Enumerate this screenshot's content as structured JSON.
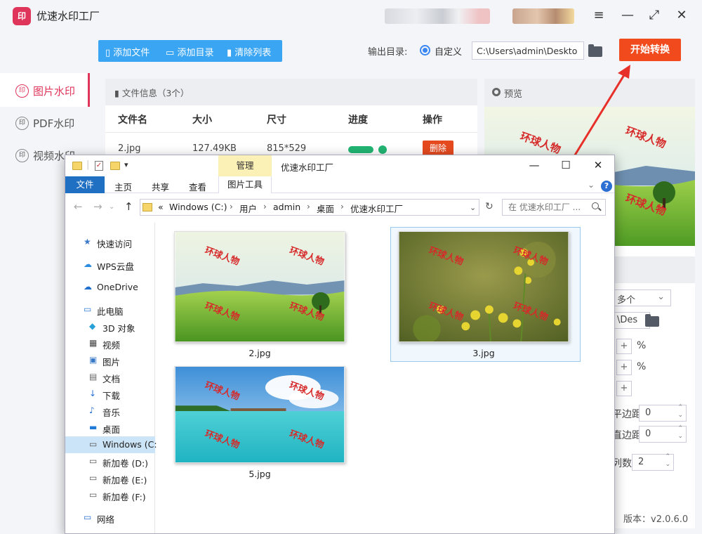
{
  "app": {
    "title": "优速水印工厂",
    "logo_text": "印",
    "window_controls": [
      "menu-icon",
      "minimize-icon",
      "maximize-icon",
      "close-icon"
    ]
  },
  "toolbar": {
    "add_file": "添加文件",
    "add_dir": "添加目录",
    "clear_list": "清除列表",
    "output_label": "输出目录:",
    "output_option": "自定义",
    "output_path": "C:\\Users\\admin\\Deskto",
    "start_button": "开始转换"
  },
  "sidebar": {
    "items": [
      {
        "label": "图片水印",
        "active": true
      },
      {
        "label": "PDF水印",
        "active": false
      },
      {
        "label": "视频水印",
        "active": false
      }
    ]
  },
  "file_panel": {
    "title": "文件信息（3个）",
    "columns": [
      "文件名",
      "大小",
      "尺寸",
      "进度",
      "操作"
    ],
    "rows": [
      {
        "name": "2.jpg",
        "size": "127.49KB",
        "dims": "815*529",
        "progress": 1.0,
        "action": "删除"
      }
    ]
  },
  "preview": {
    "title": "预览",
    "watermark_text": "环球人物"
  },
  "settings": {
    "select_value": "多个",
    "path_partial": "\\Des",
    "percent_1": "%",
    "percent_2": "%",
    "plus": "+",
    "margin_h_label": "平边距",
    "margin_h_value": "0",
    "margin_v_label": "直边距",
    "margin_v_value": "0",
    "cols_label": "列数",
    "cols_value": "2",
    "version": "版本：v2.0.6.0"
  },
  "explorer": {
    "manage_tab": "管理",
    "title": "优速水印工厂",
    "ribbon_tabs": [
      "文件",
      "主页",
      "共享",
      "查看"
    ],
    "ribbon_tools": "图片工具",
    "breadcrumb": [
      "Windows (C:)",
      "用户",
      "admin",
      "桌面",
      "优速水印工厂"
    ],
    "breadcrumb_prefix": "«",
    "search_placeholder": "在 优速水印工厂 ...",
    "nav": [
      {
        "label": "快速访问",
        "icon": "star-icon"
      },
      {
        "label": "WPS云盘",
        "icon": "cloud-icon"
      },
      {
        "label": "OneDrive",
        "icon": "onedrive-icon"
      },
      {
        "label": "此电脑",
        "icon": "pc-icon"
      },
      {
        "label": "3D 对象",
        "icon": "cube-icon"
      },
      {
        "label": "视频",
        "icon": "video-icon"
      },
      {
        "label": "图片",
        "icon": "picture-icon"
      },
      {
        "label": "文档",
        "icon": "document-icon"
      },
      {
        "label": "下载",
        "icon": "download-icon"
      },
      {
        "label": "音乐",
        "icon": "music-icon"
      },
      {
        "label": "桌面",
        "icon": "desktop-icon"
      },
      {
        "label": "Windows (C:",
        "icon": "drive-icon",
        "selected": true
      },
      {
        "label": "新加卷 (D:)",
        "icon": "drive-icon"
      },
      {
        "label": "新加卷 (E:)",
        "icon": "drive-icon"
      },
      {
        "label": "新加卷 (F:)",
        "icon": "drive-icon"
      },
      {
        "label": "网络",
        "icon": "network-icon"
      }
    ],
    "files": [
      {
        "name": "2.jpg"
      },
      {
        "name": "3.jpg",
        "selected": true
      },
      {
        "name": "5.jpg"
      }
    ]
  },
  "colors": {
    "brand": "#e0355a",
    "toolbar_blue": "#3aa5f2",
    "start_orange": "#f04a1d",
    "progress_green": "#22b573",
    "arrow_red": "#e8302a"
  }
}
